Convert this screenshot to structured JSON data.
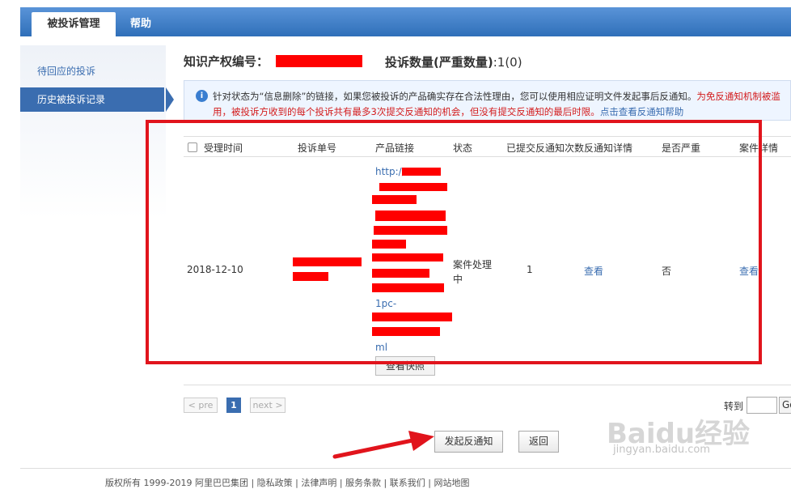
{
  "tabs": {
    "active": "被投诉管理",
    "help": "帮助"
  },
  "sidebar": {
    "items": [
      {
        "label": "待回应的投诉"
      },
      {
        "label": "历史被投诉记录"
      }
    ]
  },
  "header": {
    "ip_label": "知识产权编号：",
    "count_label": "投诉数量(严重数量)",
    "count_value": ":1(0)"
  },
  "notice": {
    "icon": "info-icon",
    "text_main": "针对状态为“信息删除”的链接，如果您被投诉的产品确实存在合法性理由，您可以使用相应证明文件发起事后反通知。",
    "text_warn": "为免反通知机制被滥用，被投诉方收到的每个投诉共有最多3次提交反通知的机会，但没有提交反通知的最后时限。",
    "text_link": "点击查看反通知帮助"
  },
  "table": {
    "headers": [
      "受理时间",
      "投诉单号",
      "产品链接",
      "状态",
      "已提交反通知次数",
      "反通知详情",
      "是否严重",
      "案件详情"
    ],
    "row": {
      "date": "2018-12-10",
      "link_start": "http://",
      "link_mid": "1pc-",
      "link_end": "ml",
      "status": "案件处理中",
      "count": "1",
      "detail": "查看",
      "serious": "否",
      "case": "查看"
    },
    "snapshot_button": "查看快照"
  },
  "pagination": {
    "prev": "< pre",
    "current": "1",
    "next": "next >",
    "goto_label": "转到",
    "go": "Go"
  },
  "actions": {
    "counter_notice": "发起反通知",
    "back": "返回"
  },
  "footer": {
    "text": "版权所有 1999-2019 阿里巴巴集团 | 隐私政策 | 法律声明 | 服务条款 | 联系我们 | 网站地图"
  },
  "watermark": {
    "brand": "Baidu经验",
    "url": "jingyan.baidu.com"
  },
  "colors": {
    "accent": "#3a6db0",
    "redaction": "#ff0000",
    "annotation": "#e1141c"
  }
}
